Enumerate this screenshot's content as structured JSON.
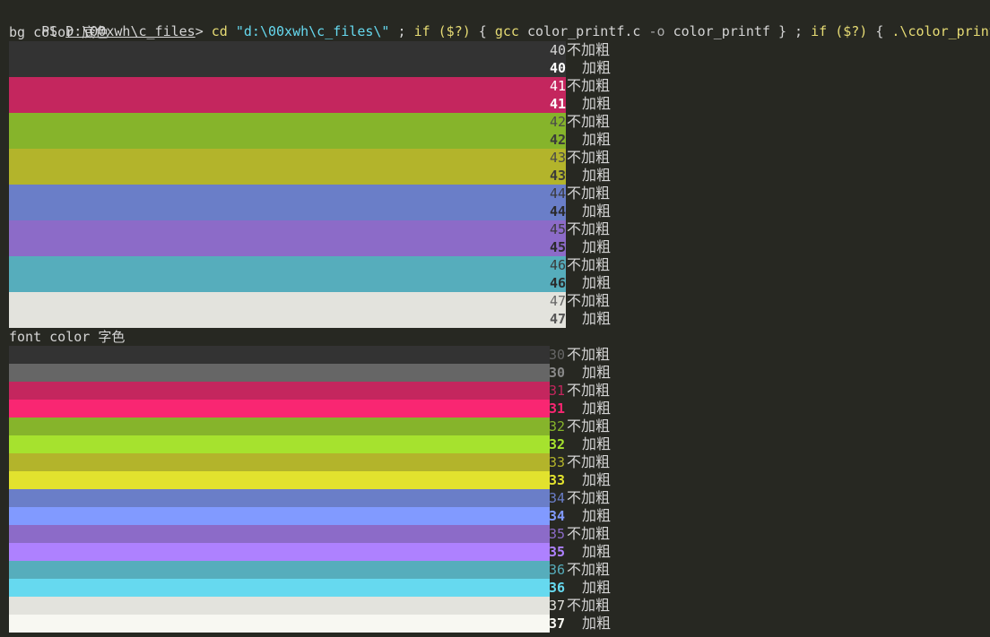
{
  "terminal": {
    "prompt": "PS ",
    "cwd": "D:\\00xwh\\c_files",
    "prompt_end": "> ",
    "command_tokens": [
      {
        "text": "cd ",
        "kind": "cmd"
      },
      {
        "text": "\"d:\\00xwh\\c_files\\\"",
        "kind": "str"
      },
      {
        "text": " ; ",
        "kind": "arg"
      },
      {
        "text": "if ",
        "kind": "cmd"
      },
      {
        "text": "($?)",
        "kind": "cmd"
      },
      {
        "text": " { ",
        "kind": "arg"
      },
      {
        "text": "gcc ",
        "kind": "cmd"
      },
      {
        "text": "color_printf.c ",
        "kind": "arg"
      },
      {
        "text": "-o ",
        "kind": "flag"
      },
      {
        "text": "color_printf",
        "kind": "arg"
      },
      {
        "text": " } ; ",
        "kind": "arg"
      },
      {
        "text": "if ",
        "kind": "cmd"
      },
      {
        "text": "($?)",
        "kind": "cmd"
      },
      {
        "text": " { ",
        "kind": "arg"
      },
      {
        "text": ".\\color_printf",
        "kind": "cmd"
      },
      {
        "text": " }",
        "kind": "arg"
      }
    ]
  },
  "bg_section": {
    "heading": "bg color 底色",
    "rows": [
      {
        "code": "40",
        "bold": false,
        "desc": "不加粗",
        "bar_color": "#333333",
        "code_color": "#d4d4d4"
      },
      {
        "code": "40",
        "bold": true,
        "desc": "加粗",
        "bar_color": "#333333",
        "code_color": "#ffffff"
      },
      {
        "code": "41",
        "bold": false,
        "desc": "不加粗",
        "bar_color": "#c4265e",
        "code_color": "#ffffff"
      },
      {
        "code": "41",
        "bold": true,
        "desc": "加粗",
        "bar_color": "#c4265e",
        "code_color": "#ffffff"
      },
      {
        "code": "42",
        "bold": false,
        "desc": "不加粗",
        "bar_color": "#86b42b",
        "code_color": "#4a4a4a"
      },
      {
        "code": "42",
        "bold": true,
        "desc": "加粗",
        "bar_color": "#86b42b",
        "code_color": "#3a3a3a"
      },
      {
        "code": "43",
        "bold": false,
        "desc": "不加粗",
        "bar_color": "#b3b42b",
        "code_color": "#4a4a4a"
      },
      {
        "code": "43",
        "bold": true,
        "desc": "加粗",
        "bar_color": "#b3b42b",
        "code_color": "#3a3a3a"
      },
      {
        "code": "44",
        "bold": false,
        "desc": "不加粗",
        "bar_color": "#6a7ec8",
        "code_color": "#3a3a3a"
      },
      {
        "code": "44",
        "bold": true,
        "desc": "加粗",
        "bar_color": "#6a7ec8",
        "code_color": "#2a2a2a"
      },
      {
        "code": "45",
        "bold": false,
        "desc": "不加粗",
        "bar_color": "#8c6bc8",
        "code_color": "#3a3a3a"
      },
      {
        "code": "45",
        "bold": true,
        "desc": "加粗",
        "bar_color": "#8c6bc8",
        "code_color": "#2a2a2a"
      },
      {
        "code": "46",
        "bold": false,
        "desc": "不加粗",
        "bar_color": "#56adbc",
        "code_color": "#3a3a3a"
      },
      {
        "code": "46",
        "bold": true,
        "desc": "加粗",
        "bar_color": "#56adbc",
        "code_color": "#2a2a2a"
      },
      {
        "code": "47",
        "bold": false,
        "desc": "不加粗",
        "bar_color": "#e3e3dd",
        "code_color": "#666666"
      },
      {
        "code": "47",
        "bold": true,
        "desc": "加粗",
        "bar_color": "#e3e3dd",
        "code_color": "#555555"
      }
    ]
  },
  "fg_section": {
    "heading": "font color 字色",
    "rows": [
      {
        "code": "30",
        "bold": false,
        "desc": "不加粗",
        "bar_color": "#333333",
        "code_color": "#666666"
      },
      {
        "code": "30",
        "bold": true,
        "desc": "加粗",
        "bar_color": "#666666",
        "code_color": "#888888"
      },
      {
        "code": "31",
        "bold": false,
        "desc": "不加粗",
        "bar_color": "#c4265e",
        "code_color": "#c4265e"
      },
      {
        "code": "31",
        "bold": true,
        "desc": "加粗",
        "bar_color": "#f92672",
        "code_color": "#f92672"
      },
      {
        "code": "32",
        "bold": false,
        "desc": "不加粗",
        "bar_color": "#86b42b",
        "code_color": "#86b42b"
      },
      {
        "code": "32",
        "bold": true,
        "desc": "加粗",
        "bar_color": "#a6e22e",
        "code_color": "#a6e22e"
      },
      {
        "code": "33",
        "bold": false,
        "desc": "不加粗",
        "bar_color": "#b3b42b",
        "code_color": "#b3b42b"
      },
      {
        "code": "33",
        "bold": true,
        "desc": "加粗",
        "bar_color": "#e2e22e",
        "code_color": "#e2e22e"
      },
      {
        "code": "34",
        "bold": false,
        "desc": "不加粗",
        "bar_color": "#6a7ec8",
        "code_color": "#6a7ec8"
      },
      {
        "code": "34",
        "bold": true,
        "desc": "加粗",
        "bar_color": "#819aff",
        "code_color": "#819aff"
      },
      {
        "code": "35",
        "bold": false,
        "desc": "不加粗",
        "bar_color": "#8c6bc8",
        "code_color": "#8c6bc8"
      },
      {
        "code": "35",
        "bold": true,
        "desc": "加粗",
        "bar_color": "#ae81ff",
        "code_color": "#ae81ff"
      },
      {
        "code": "36",
        "bold": false,
        "desc": "不加粗",
        "bar_color": "#56adbc",
        "code_color": "#56adbc"
      },
      {
        "code": "36",
        "bold": true,
        "desc": "加粗",
        "bar_color": "#66d9ef",
        "code_color": "#66d9ef"
      },
      {
        "code": "37",
        "bold": false,
        "desc": "不加粗",
        "bar_color": "#e3e3dd",
        "code_color": "#e3e3dd"
      },
      {
        "code": "37",
        "bold": true,
        "desc": "加粗",
        "bar_color": "#f8f8f2",
        "code_color": "#f8f8f2"
      }
    ]
  }
}
